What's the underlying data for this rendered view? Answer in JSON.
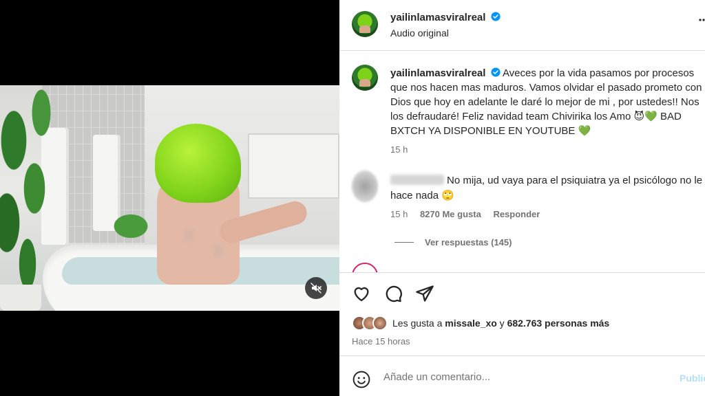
{
  "post": {
    "username": "yailinlamasviralreal",
    "audio": "Audio original",
    "caption": "Aveces por la vida pasamos por procesos que nos hacen mas maduros. Vamos olvidar el pasado prometo con Dios que hoy en adelante le daré lo mejor de mi , por ustedes!! Nos los defraudaré! Feliz navidad team Chivirika los Amo 😈💚 BAD BXTCH YA DISPONIBLE EN YOUTUBE 💚",
    "caption_time": "15 h"
  },
  "comment": {
    "text": "No mija, ud vaya para el psiquiatra ya el psicólogo no le hace nada 🙄",
    "time": "15 h",
    "likes": "8270 Me gusta",
    "reply": "Responder",
    "view_replies": "Ver respuestas (145)"
  },
  "likes": {
    "prefix": "Les gusta a",
    "user": "missale_xo",
    "joiner": "y",
    "count": "682.763 personas más"
  },
  "posted_ago": "Hace 15 horas",
  "composer": {
    "placeholder": "Añade un comentario...",
    "publish": "Publicar"
  },
  "colors": {
    "verified_blue": "#0095f6",
    "muted_text": "#737373",
    "publish_disabled": "#b2dffc"
  },
  "icons": [
    "volume-muted-icon",
    "verified-badge-icon",
    "more-options-icon",
    "heart-icon",
    "comment-icon",
    "share-icon",
    "emoji-icon"
  ]
}
